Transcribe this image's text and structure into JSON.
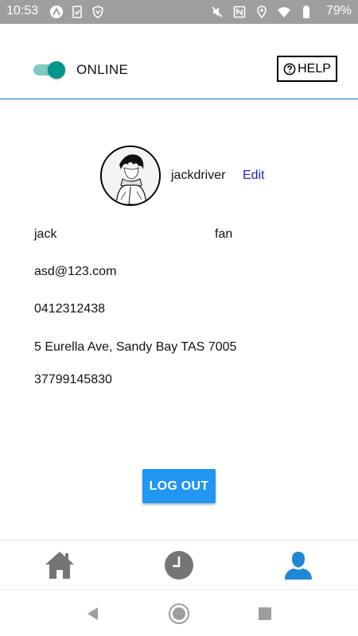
{
  "status_bar": {
    "time": "10:53",
    "battery_percent": "79%"
  },
  "header": {
    "toggle_on": true,
    "status_label": "ONLINE",
    "help_label": "HELP"
  },
  "profile": {
    "username": "jackdriver",
    "edit_label": "Edit",
    "first_name": "jack",
    "last_name": "fan",
    "email": "asd@123.com",
    "phone": "0412312438",
    "address": "5 Eurella Ave, Sandy Bay TAS 7005",
    "number": "37799145830"
  },
  "actions": {
    "logout_label": "LOG OUT"
  },
  "colors": {
    "toggle_active": "#009688",
    "accent_blue": "#2196f3",
    "link_blue": "#2020d0",
    "tab_inactive": "#757575",
    "tab_active": "#1e88d6"
  },
  "tabs": [
    {
      "icon": "home-icon",
      "active": false
    },
    {
      "icon": "clock-icon",
      "active": false
    },
    {
      "icon": "person-icon",
      "active": true
    }
  ]
}
